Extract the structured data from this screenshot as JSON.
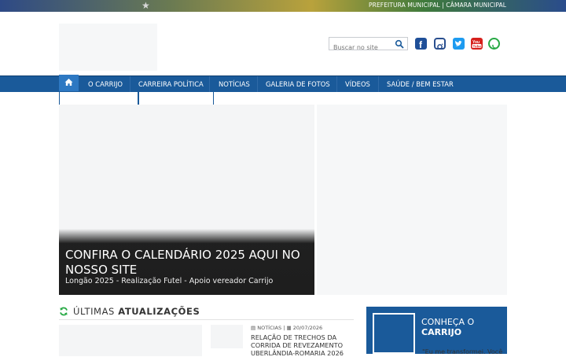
{
  "topbar": {
    "links": "PREFEITURA MUNICIPAL | CÂMARA MUNICIPAL",
    "star": "★"
  },
  "search": {
    "placeholder": "Buscar no site"
  },
  "social": [
    "facebook-icon",
    "instagram-icon",
    "twitter-icon",
    "youtube-icon",
    "whatsapp-icon"
  ],
  "nav": {
    "items": [
      "O CARRIJO",
      "CARREIRA POLÍTICA",
      "NOTÍCIAS",
      "GALERIA DE FOTOS",
      "VÍDEOS",
      "SAÚDE / BEM ESTAR"
    ]
  },
  "hero": {
    "title": "CONFIRA O CALENDÁRIO 2025 AQUI NO NOSSO SITE",
    "subtitle": "Longão 2025 - Realização Futel - Apoio vereador Carrijo"
  },
  "updates": {
    "light": "ÚLTIMAS",
    "bold": "ATUALIZAÇÕES"
  },
  "news": {
    "category": "NOTÍCIAS",
    "date": "20/07/2026",
    "title": "RELAÇÃO DE TRECHOS DA CORRIDA DE REVEZAMENTO UBERLÂNDIA-ROMARIA 2026"
  },
  "profile": {
    "line1": "CONHEÇA O",
    "line2": "CARRIJO",
    "quote": "\"Eu me transformei. Você"
  },
  "colors": {
    "nav": "#1a5a9a",
    "home": "#2d78c2",
    "accent": "#27a944"
  }
}
